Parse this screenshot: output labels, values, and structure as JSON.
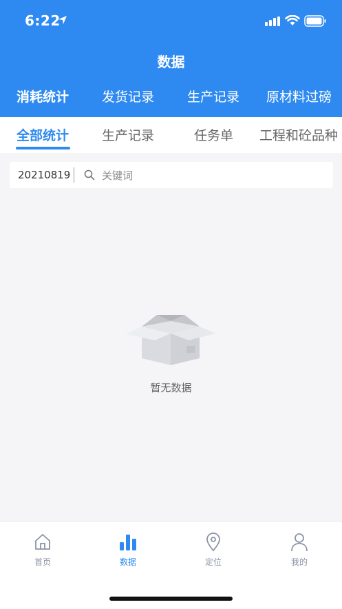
{
  "status_bar": {
    "time": "6:22"
  },
  "header": {
    "title": "数据"
  },
  "top_tabs": [
    {
      "label": "消耗统计",
      "active": true
    },
    {
      "label": "发货记录",
      "active": false
    },
    {
      "label": "生产记录",
      "active": false
    },
    {
      "label": "原材料过磅",
      "active": false
    }
  ],
  "sub_tabs": [
    {
      "label": "全部统计",
      "active": true
    },
    {
      "label": "生产记录",
      "active": false
    },
    {
      "label": "任务单",
      "active": false
    },
    {
      "label": "工程和砼品种",
      "active": false
    }
  ],
  "filter": {
    "date": "20210819",
    "search_placeholder": "关键词",
    "search_value": ""
  },
  "empty_state": {
    "text": "暂无数据",
    "icon": "empty-box-icon"
  },
  "bottom_nav": [
    {
      "label": "首页",
      "icon": "home-icon",
      "active": false
    },
    {
      "label": "数据",
      "icon": "bar-chart-icon",
      "active": true
    },
    {
      "label": "定位",
      "icon": "location-pin-icon",
      "active": false
    },
    {
      "label": "我的",
      "icon": "user-icon",
      "active": false
    }
  ],
  "colors": {
    "primary": "#2e8af0",
    "background": "#f5f5f7",
    "nav_inactive": "#8a94a6"
  }
}
